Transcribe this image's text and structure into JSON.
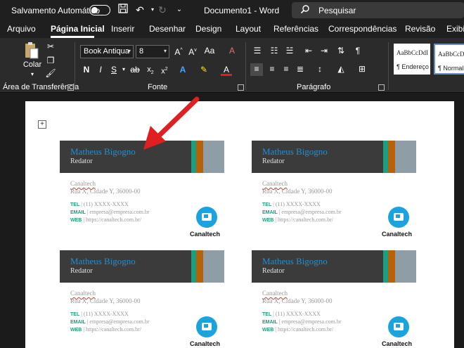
{
  "titlebar": {
    "autosave_label": "Salvamento Automático",
    "doc_title": "Documento1  -  Word",
    "search_placeholder": "Pesquisar"
  },
  "tabs": [
    "Arquivo",
    "Página Inicial",
    "Inserir",
    "Desenhar",
    "Design",
    "Layout",
    "Referências",
    "Correspondências",
    "Revisão",
    "Exibir"
  ],
  "active_tab": "Página Inicial",
  "ribbon": {
    "clipboard": {
      "paste_label": "Colar",
      "group_label": "Área de Transferência"
    },
    "font": {
      "family": "Book Antiqua",
      "size": "8",
      "group_label": "Fonte"
    },
    "paragraph": {
      "group_label": "Parágrafo"
    },
    "styles": [
      {
        "preview": "AaBbCcDdI",
        "name": "¶ Endereço"
      },
      {
        "preview": "AaBbCcDd",
        "name": "¶ Normal"
      }
    ]
  },
  "cards": [
    {
      "name": "Matheus Bigogno",
      "role": "Redator",
      "company": "Canaltech",
      "address": "Rua X, Cidade Y, 36000-00",
      "tel_label": "TEL",
      "tel": "(11) XXXX-XXXX",
      "email_label": "EMAIL",
      "email": "empresa@empresa.com.br",
      "web_label": "WEB",
      "web": "https://canaltech.com.br/",
      "logo_text": "Canaltech"
    }
  ],
  "colors": {
    "accent_blue": "#1e8fd6",
    "band_dark": "#3b3b3b",
    "stripe_green": "#1c9f80",
    "stripe_orange": "#b7610b",
    "stripe_gray": "#8f9ea6",
    "annotation_arrow": "#e02020"
  }
}
